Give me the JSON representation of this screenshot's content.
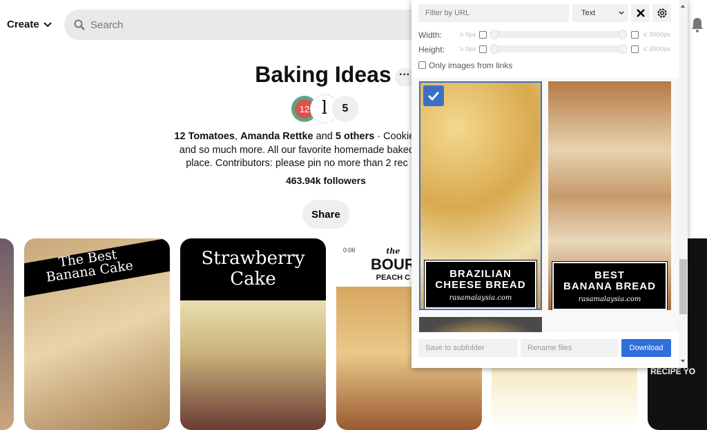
{
  "header": {
    "create_label": "Create",
    "search_placeholder": "Search"
  },
  "board": {
    "title": "Baking Ideas",
    "avatar_count": "5",
    "desc_line1_bold1": "12 Tomatoes",
    "desc_line1_sep": ", ",
    "desc_line1_bold2": "Amanda Rettke",
    "desc_line1_mid": " and ",
    "desc_line1_bold3": "5 others",
    "desc_line1_rest": " · Cookies",
    "desc_line2": "and so much more. All our favorite homemade baked",
    "desc_line3": "place. Contributors: please pin no more than 2 rec",
    "followers": "463.94k followers",
    "share_label": "Share",
    "avatar1_text": "12"
  },
  "pins": [
    {
      "text1": "The Best",
      "text2": "Banana Cake"
    },
    {
      "text1": "Strawberry",
      "text2": "Cake"
    },
    {
      "duration": "0:06",
      "text1": "the",
      "text2": "BOUR",
      "text3": "PEACH C"
    },
    {
      "text1": "RECIPE YO"
    }
  ],
  "panel": {
    "filter_placeholder": "Filter by URL",
    "select_value": "Text",
    "width_label": "Width:",
    "height_label": "Height:",
    "min_label": "≥ 0px",
    "max_label": "≤ 3000px",
    "only_links_label": "Only images from links",
    "images": [
      {
        "line1": "BRAZILIAN",
        "line2": "CHEESE BREAD",
        "site": "rasamalaysia.com",
        "selected": true
      },
      {
        "line1": "BEST",
        "line2": "BANANA BREAD",
        "site": "rasamalaysia.com",
        "selected": false
      }
    ],
    "subfolder_placeholder": "Save to subfolder",
    "rename_placeholder": "Rename files",
    "download_label": "Download",
    "accent": "#2f6fdb"
  }
}
